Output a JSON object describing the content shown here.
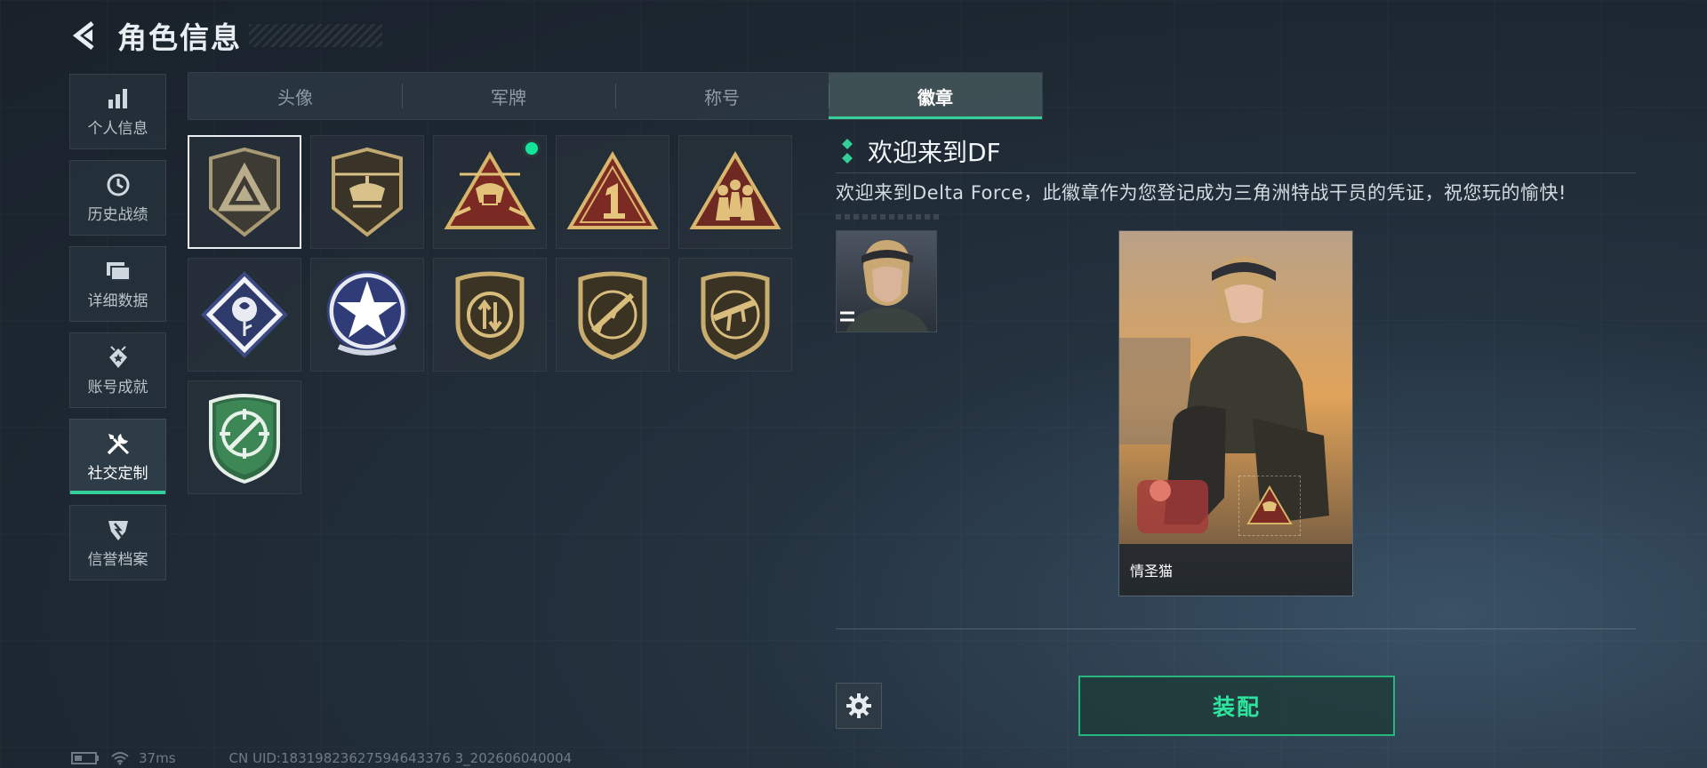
{
  "header": {
    "title": "角色信息"
  },
  "nav": {
    "items": [
      {
        "label": "个人信息",
        "icon": "bar-chart-icon",
        "active": false
      },
      {
        "label": "历史战绩",
        "icon": "clock-icon",
        "active": false
      },
      {
        "label": "详细数据",
        "icon": "folder-icon",
        "active": false
      },
      {
        "label": "账号成就",
        "icon": "achievement-icon",
        "active": false
      },
      {
        "label": "社交定制",
        "icon": "tools-icon",
        "active": true
      },
      {
        "label": "信誉档案",
        "icon": "shield-icon",
        "active": false
      }
    ]
  },
  "tabs": [
    {
      "label": "头像",
      "active": false
    },
    {
      "label": "军牌",
      "active": false
    },
    {
      "label": "称号",
      "active": false
    },
    {
      "label": "徽章",
      "active": true
    }
  ],
  "badges": [
    {
      "icon": "delta-triangle-badge-icon",
      "selected": true,
      "new": false
    },
    {
      "icon": "helicopter-badge-icon",
      "selected": false,
      "new": false
    },
    {
      "icon": "soldier-helicopter-badge-icon",
      "selected": false,
      "new": true
    },
    {
      "icon": "number-one-badge-icon",
      "selected": false,
      "new": false
    },
    {
      "icon": "squad-badge-icon",
      "selected": false,
      "new": false
    },
    {
      "icon": "rose-badge-icon",
      "selected": false,
      "new": false
    },
    {
      "icon": "star-badge-icon",
      "selected": false,
      "new": false
    },
    {
      "icon": "arrow-shield-badge-icon",
      "selected": false,
      "new": false
    },
    {
      "icon": "rifle-badge-icon",
      "selected": false,
      "new": false
    },
    {
      "icon": "smg-badge-icon",
      "selected": false,
      "new": false
    },
    {
      "icon": "green-crosshair-badge-icon",
      "selected": false,
      "new": false
    }
  ],
  "detail": {
    "title": "欢迎来到DF",
    "description": "欢迎来到Delta Force，此徽章作为您登记成为三角洲特战干员的凭证，祝您玩的愉快!"
  },
  "card": {
    "name": "情圣猫"
  },
  "actions": {
    "equip_label": "装配"
  },
  "status": {
    "ping": "37ms",
    "uid": "CN UID:18319823627594643376 3_202606040004"
  },
  "colors": {
    "accent": "#35d09a",
    "equip_text": "#2de39e"
  }
}
